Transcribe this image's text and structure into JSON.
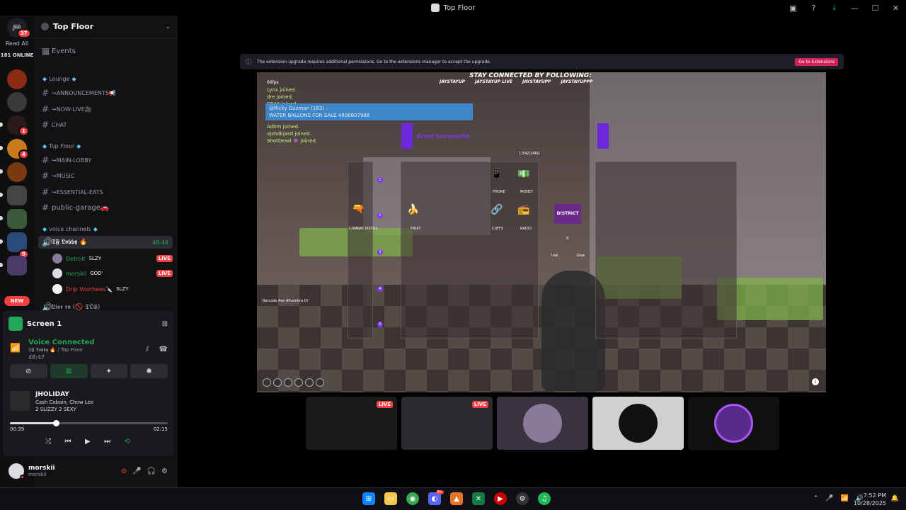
{
  "window": {
    "title": "Top Floor"
  },
  "rail": {
    "mention_count": "37",
    "read_all": "Read All",
    "online": "181 ONLINE",
    "badges": [
      "1",
      "4",
      "9"
    ],
    "new_label": "NEW"
  },
  "server": {
    "name": "Top Floor"
  },
  "sidebar": {
    "events": "Events",
    "categories": {
      "lounge": "Lounge",
      "top_floor": "Top Floor",
      "voice": "voice channels"
    },
    "channels": {
      "announcements": "↪announcements📢",
      "now_live": "↪now-live🎥",
      "chat": "chat",
      "main_lobby": "↪main-lobby",
      "music": "↪music",
      "essential_eats": "↪essential-eats",
      "public_garage": "public-garage🚗",
      "tf_lobby": "𝕿𝕱 𝕷𝖔𝖇𝖇𝖞 🔥",
      "tf_lobby_time": "48:44",
      "live_rn": "𝕷𝖎𝖛𝖊 𝖗𝖓 (🚫 𝕿𝕺𝕾)"
    },
    "voice_users": [
      {
        "name": "Detroit",
        "tag": "SLZY",
        "live": "LIVE",
        "color": "#23a55a"
      },
      {
        "name": "morskii",
        "tag": "GOD'",
        "live": "LIVE",
        "color": "#23a55a"
      },
      {
        "name": "Drip Voorhees🔪",
        "tag": "SLZY",
        "live": "",
        "color": "#f23f43"
      }
    ]
  },
  "screen_share": {
    "title": "Screen 1"
  },
  "voice": {
    "status": "Voice Connected",
    "channel": "𝕿𝕱 𝕷𝖔𝖇𝖇𝖞 🔥 / Top Floor",
    "elapsed": "48:47"
  },
  "now_playing": {
    "title": "JHOLIDAY",
    "artists": "Cash Cobain, Chow Lee",
    "album": "2 SLIZZY 2 SEXY",
    "current": "00:39",
    "total": "02:15",
    "progress": 0.29
  },
  "user": {
    "name": "morskii",
    "handle": "morskii"
  },
  "banner": {
    "message": "The extension upgrade requires additional permissions. Go to the extensions manager to accept the upgrade.",
    "button": "Go to Extensions"
  },
  "game": {
    "follow_title": "STAY CONNECTED BY FOLLOWING:",
    "socials": [
      "JAYSTAYUP",
      "JAYSTAYUP LIVE",
      "JAYSTAYUPP",
      "JAYSTAYUPPP"
    ],
    "fps": "66fps",
    "chat_top": [
      "Lynx joined.",
      "dre joined.",
      "CRAY joined."
    ],
    "ricky_line1": "@Ricky Guzman (163) :",
    "ricky_line2": "WATER BALLONS FOR SALE 4806807988",
    "chat_bottom": [
      "Adhm joined.",
      "ajshdkjasd joined.",
      "ShotDead 👾 joined."
    ],
    "weapon_name": "Ernst Sommerlin",
    "weight": "1,542/24KG",
    "slot_nums": [
      "1",
      "2",
      "3",
      "4",
      "5"
    ],
    "item_labels": [
      "COMBAT PISTOL",
      "FRUIT",
      "PHONE",
      "MONEY",
      "CUFFS",
      "RADIO"
    ],
    "district": "DISTRICT",
    "amount": "0",
    "use": "Use",
    "give": "Give",
    "location": "Barcode Ave Alhambra Dr"
  },
  "thumbs": {
    "live": "LIVE"
  },
  "taskbar": {
    "time": "7:52 PM",
    "date": "10/28/2025",
    "discord_badge": "9+"
  }
}
